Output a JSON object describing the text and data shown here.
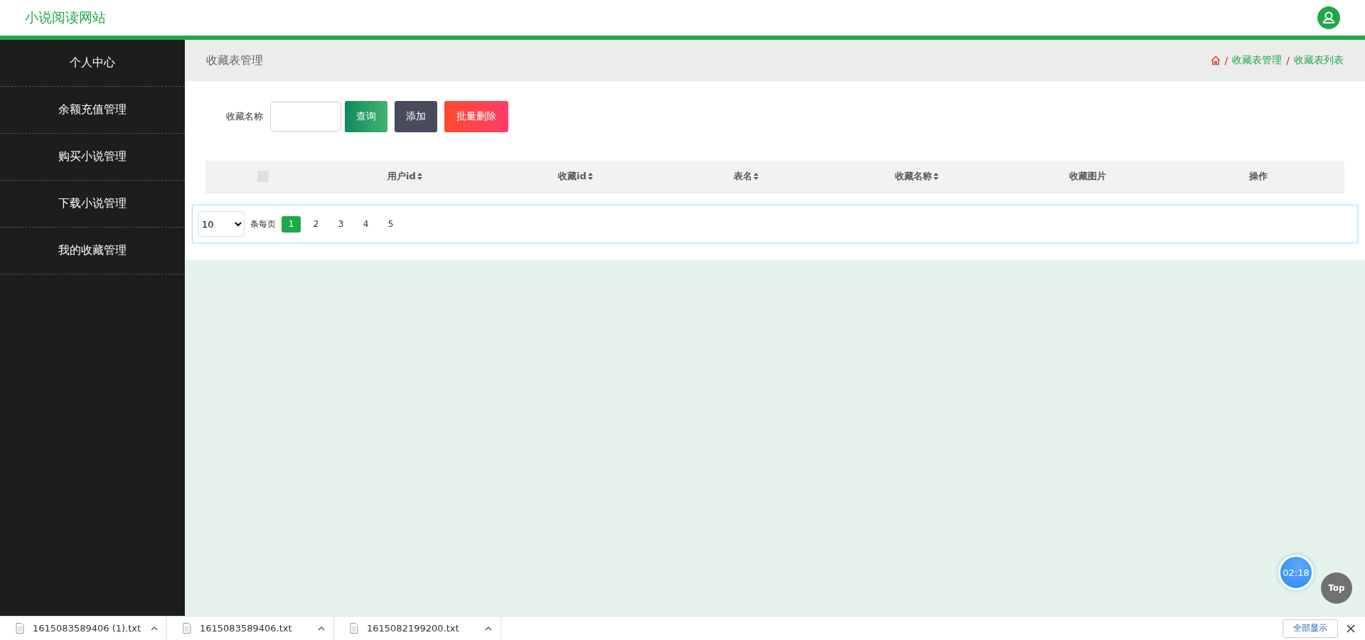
{
  "header": {
    "site_title": "小说阅读网站"
  },
  "sidebar": {
    "items": [
      {
        "label": "个人中心"
      },
      {
        "label": "余额充值管理"
      },
      {
        "label": "购买小说管理"
      },
      {
        "label": "下载小说管理"
      },
      {
        "label": "我的收藏管理"
      }
    ]
  },
  "page_header": {
    "title": "收藏表管理",
    "breadcrumbs": [
      "收藏表管理",
      "收藏表列表"
    ],
    "separator": "/"
  },
  "search": {
    "label": "收藏名称",
    "buttons": [
      {
        "label": "查询",
        "kind": "search"
      },
      {
        "label": "添加",
        "kind": "add"
      },
      {
        "label": "批量删除",
        "kind": "delete"
      }
    ]
  },
  "table": {
    "select_all_checked": false,
    "columns": [
      {
        "label": "用户id",
        "sortable": true
      },
      {
        "label": "收藏id",
        "sortable": true
      },
      {
        "label": "表名",
        "sortable": true
      },
      {
        "label": "收藏名称",
        "sortable": true
      },
      {
        "label": "收藏图片",
        "sortable": false
      },
      {
        "label": "操作",
        "sortable": false
      }
    ]
  },
  "pagination": {
    "page_size": "10",
    "page_size_suffix": "条每页",
    "pages": [
      {
        "label": "1",
        "selected": true
      },
      {
        "label": "2",
        "selected": false
      },
      {
        "label": "3",
        "selected": false
      },
      {
        "label": "4",
        "selected": false
      },
      {
        "label": "5",
        "selected": false
      }
    ]
  },
  "timer": "02:18",
  "top_button": "Top",
  "downloads": {
    "items": [
      {
        "name": "1615083589406 (1).txt"
      },
      {
        "name": "1615083589406.txt"
      },
      {
        "name": "1615082199200.txt"
      }
    ],
    "show_all": "全部显示"
  }
}
